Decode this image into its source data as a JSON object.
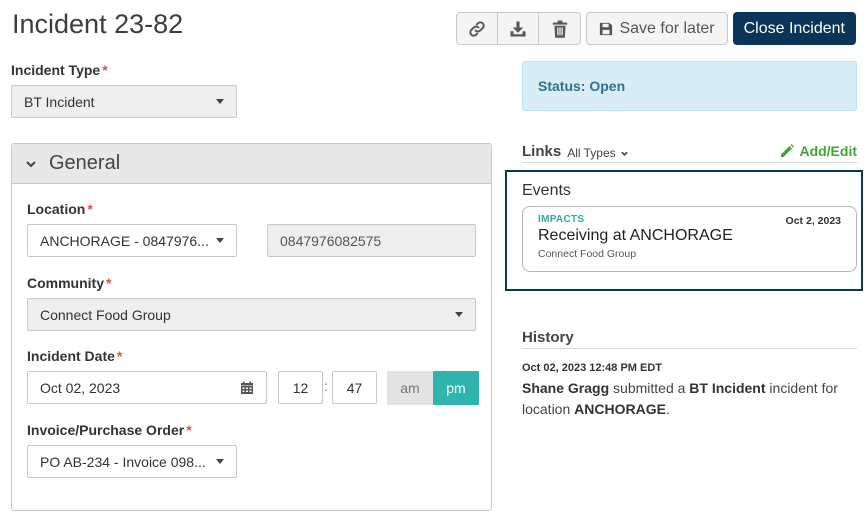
{
  "page": {
    "title": "Incident 23-82"
  },
  "toolbar": {
    "icons": [
      "link-icon",
      "download-icon",
      "trash-icon"
    ],
    "save_label": "Save for later",
    "close_label": "Close Incident",
    "accent": "#0b3558"
  },
  "incident_type": {
    "label": "Incident Type",
    "required": "*",
    "value": "BT Incident"
  },
  "status": {
    "text": "Status: Open",
    "bg": "#d9edf7"
  },
  "general": {
    "title": "General",
    "location": {
      "label": "Location",
      "required": "*",
      "value": "ANCHORAGE - 0847976...",
      "code": "0847976082575"
    },
    "community": {
      "label": "Community",
      "required": "*",
      "value": "Connect Food Group"
    },
    "incident_date": {
      "label": "Incident Date",
      "required": "*",
      "date": "Oct 02, 2023",
      "hour": "12",
      "minute": "47",
      "separator": ":",
      "am": "am",
      "pm": "pm",
      "selected": "pm"
    },
    "invoice": {
      "label": "Invoice/Purchase Order",
      "required": "*",
      "value": "PO AB-234 - Invoice 098..."
    }
  },
  "links": {
    "title": "Links",
    "filter": "All Types",
    "add_edit": "Add/Edit"
  },
  "events": {
    "title": "Events",
    "items": [
      {
        "type": "IMPACTS",
        "date": "Oct 2, 2023",
        "name": "Receiving at ANCHORAGE",
        "sub": "Connect Food Group"
      }
    ]
  },
  "history": {
    "title": "History",
    "entries": [
      {
        "time": "Oct 02, 2023 12:48 PM EDT",
        "user": "Shane Gragg",
        "text1": " submitted a ",
        "type": "BT Incident",
        "text2": " incident for location ",
        "location": "ANCHORAGE",
        "text3": "."
      }
    ]
  }
}
